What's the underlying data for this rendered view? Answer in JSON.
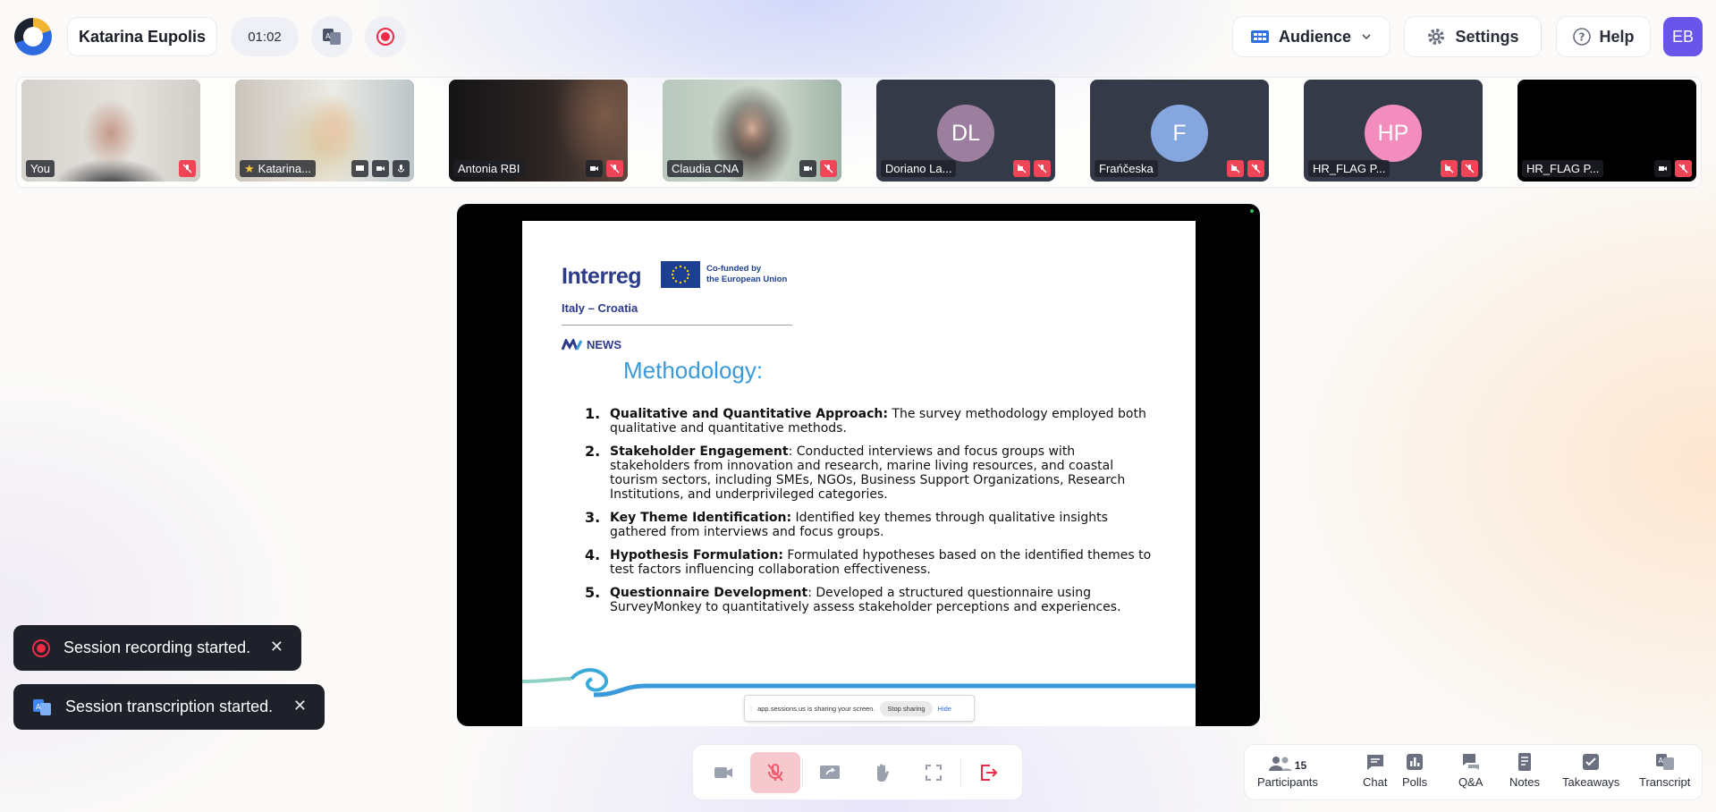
{
  "header": {
    "host_name": "Katarina Eupolis",
    "timer": "01:02",
    "audience_label": "Audience",
    "settings_label": "Settings",
    "help_label": "Help",
    "user_initials": "EB"
  },
  "participants": [
    {
      "name": "You"
    },
    {
      "name": "Katarina..."
    },
    {
      "name": "Antonia RBI"
    },
    {
      "name": "Claudia CNA"
    },
    {
      "name": "Doriano La...",
      "initials": "DL",
      "color": "#9c7f9e"
    },
    {
      "name": "Frańčeska",
      "initials": "F",
      "color": "#86a6e0"
    },
    {
      "name": "HR_FLAG P...",
      "initials": "HP",
      "color": "#f28dbd"
    },
    {
      "name": "HR_FLAG P..."
    }
  ],
  "slide": {
    "logo_text": "Interreg",
    "cofunded_line1": "Co-funded by",
    "cofunded_line2": "the European Union",
    "region": "Italy – Croatia",
    "news": "NEWS",
    "title": "Methodology:",
    "items": [
      {
        "num": "1.",
        "bold": "Qualitative and Quantitative Approach:",
        "text": " The survey methodology employed both qualitative and quantitative methods."
      },
      {
        "num": "2.",
        "bold": "Stakeholder Engagement",
        "text": ": Conducted interviews and focus groups with stakeholders from innovation and research, marine living resources, and coastal tourism sectors, including SMEs, NGOs, Business Support Organizations, Research Institutions, and underprivileged categories."
      },
      {
        "num": "3.",
        "bold": "Key Theme Identification:",
        "text": " Identified key themes through qualitative insights gathered from interviews and focus groups."
      },
      {
        "num": "4.",
        "bold": "Hypothesis Formulation:",
        "text": " Formulated hypotheses based on the identified themes to test factors influencing collaboration effectiveness."
      },
      {
        "num": "5.",
        "bold": "Questionnaire Development",
        "text": ": Developed a structured questionnaire using SurveyMonkey to quantitatively assess stakeholder perceptions and experiences."
      }
    ],
    "share_text": "app.sessions.us is sharing your screen.",
    "stop_sharing": "Stop sharing",
    "hide": "Hide"
  },
  "toasts": {
    "recording": "Session recording started.",
    "transcription": "Session transcription started.",
    "close": "✕"
  },
  "panel": {
    "participants_count": "15",
    "participants": "Participants",
    "chat": "Chat",
    "polls": "Polls",
    "qa": "Q&A",
    "notes": "Notes",
    "takeaways": "Takeaways",
    "transcript": "Transcript"
  },
  "icons": {
    "controls": [
      "camera-icon",
      "mic-off-icon",
      "screen-share-icon",
      "hand-icon",
      "fullscreen-icon",
      "leave-icon"
    ]
  },
  "colors": {
    "accent": "#6a55ea",
    "danger": "#f04457",
    "brand_blue": "#2b3a89",
    "slide_title": "#3a9ad9"
  }
}
